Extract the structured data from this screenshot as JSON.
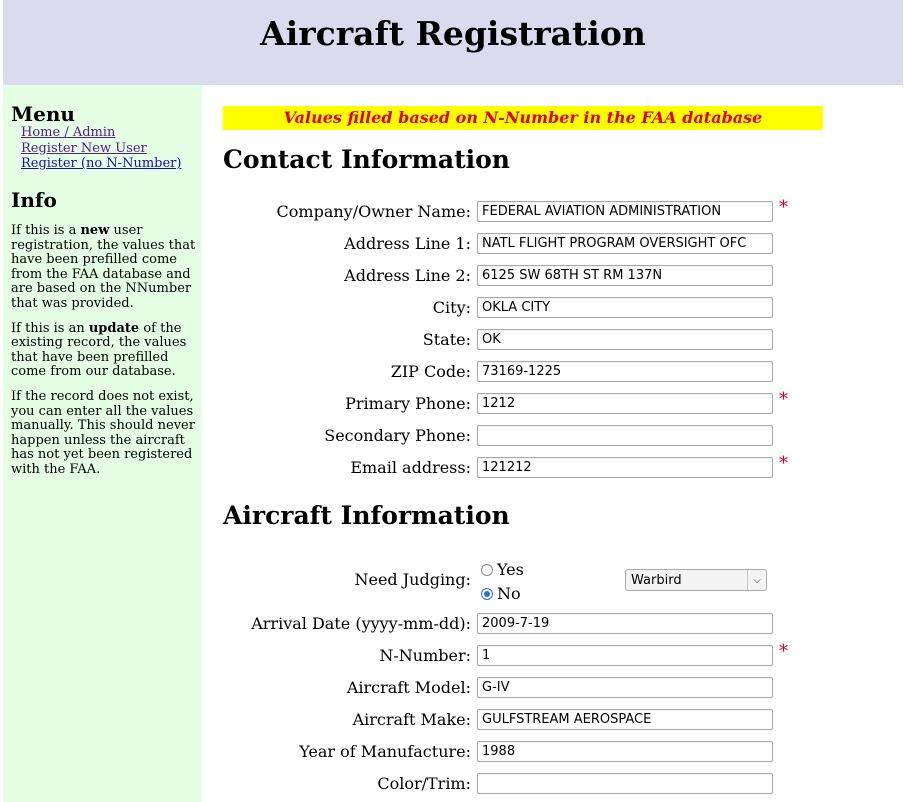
{
  "page": {
    "title": "Aircraft Registration"
  },
  "sidebar": {
    "menu_title": "Menu",
    "menu_items": [
      {
        "label": "Home / Admin"
      },
      {
        "label": "Register New User"
      },
      {
        "label": "Register (no N-Number)"
      }
    ],
    "info_title": "Info",
    "info": {
      "p1_a": "If this is a ",
      "p1_b": "new",
      "p1_c": " user registration, the values that have been prefilled come from the FAA database and are based on the NNumber that was provided.",
      "p2_a": "If this is an ",
      "p2_b": "update",
      "p2_c": " of the existing record, the values that have been prefilled come from our database.",
      "p3": "If the record does not exist, you can enter all the values manually. This should never happen unless the aircraft has not yet been registered with the FAA."
    }
  },
  "notice": "Values filled based on N-Number in the FAA database",
  "contact": {
    "title": "Contact Information",
    "fields": [
      {
        "label": "Company/Owner Name:",
        "value": "FEDERAL AVIATION ADMINISTRATION",
        "required": true
      },
      {
        "label": "Address Line 1:",
        "value": "NATL FLIGHT PROGRAM OVERSIGHT OFC",
        "required": false
      },
      {
        "label": "Address Line 2:",
        "value": "6125 SW 68TH ST RM 137N",
        "required": false
      },
      {
        "label": "City:",
        "value": "OKLA CITY",
        "required": false
      },
      {
        "label": "State:",
        "value": "OK",
        "required": false
      },
      {
        "label": "ZIP Code:",
        "value": "73169-1225",
        "required": false
      },
      {
        "label": "Primary Phone:",
        "value": "1212",
        "required": true
      },
      {
        "label": "Secondary Phone:",
        "value": "",
        "required": false
      },
      {
        "label": "Email address:",
        "value": "121212",
        "required": true
      }
    ]
  },
  "aircraft": {
    "title": "Aircraft Information",
    "judging_label": "Need Judging:",
    "judging_options": [
      "Yes",
      "No"
    ],
    "judging_selected": "No",
    "category_selected": "Warbird",
    "fields": [
      {
        "label": "Arrival Date (yyyy-mm-dd):",
        "value": "2009-7-19",
        "required": false
      },
      {
        "label": "N-Number:",
        "value": "1",
        "required": true
      },
      {
        "label": "Aircraft Model:",
        "value": "G-IV",
        "required": false
      },
      {
        "label": "Aircraft Make:",
        "value": "GULFSTREAM AEROSPACE",
        "required": false
      },
      {
        "label": "Year of Manufacture:",
        "value": "1988",
        "required": false
      },
      {
        "label": "Color/Trim:",
        "value": "",
        "required": false
      }
    ]
  },
  "required_marker": "*"
}
